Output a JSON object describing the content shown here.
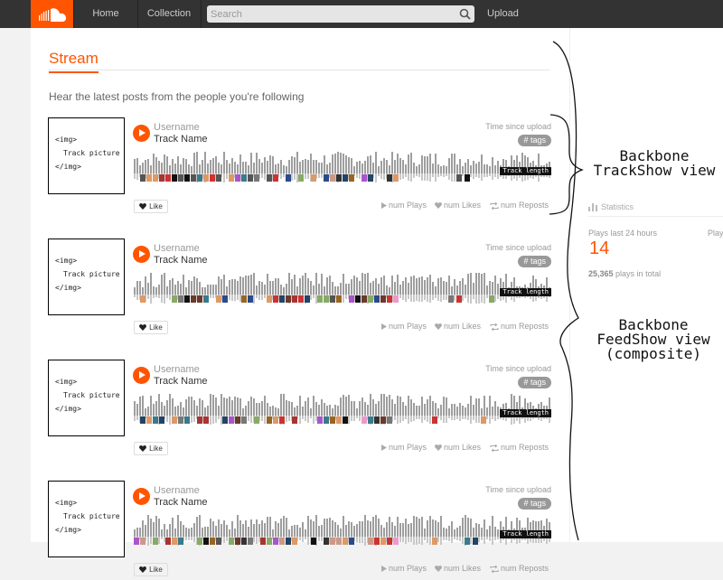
{
  "nav": {
    "home": "Home",
    "collection": "Collection",
    "search_placeholder": "Search",
    "upload": "Upload"
  },
  "stream": {
    "title": "Stream",
    "description": "Hear the latest posts from the people you're following"
  },
  "tracks": [
    {
      "art_lines": [
        "<img>",
        "Track picture",
        "</img>"
      ],
      "username": "Username",
      "track_name": "Track Name",
      "time_since": "Time since upload",
      "tags": "# tags",
      "length": "Track length",
      "like": "Like",
      "plays": "num Plays",
      "likes": "num Likes",
      "reposts": "num Reposts"
    },
    {
      "art_lines": [
        "<img>",
        "Track picture",
        "</img>"
      ],
      "username": "Username",
      "track_name": "Track Name",
      "time_since": "Time since upload",
      "tags": "# tags",
      "length": "Track length",
      "like": "Like",
      "plays": "num Plays",
      "likes": "num Likes",
      "reposts": "num Reposts"
    },
    {
      "art_lines": [
        "<img>",
        "Track picture",
        "</img>"
      ],
      "username": "Username",
      "track_name": "Track Name",
      "time_since": "Time since upload",
      "tags": "# tags",
      "length": "Track length",
      "like": "Like",
      "plays": "num Plays",
      "likes": "num Likes",
      "reposts": "num Reposts"
    },
    {
      "art_lines": [
        "<img>",
        "Track picture",
        "</img>"
      ],
      "username": "Username",
      "track_name": "Track Name",
      "time_since": "Time since upload",
      "tags": "# tags",
      "length": "Track length",
      "like": "Like",
      "plays": "num Plays",
      "likes": "num Likes",
      "reposts": "num Reposts"
    }
  ],
  "sidebar": {
    "statistics_label": "Statistics",
    "plays_24h_label": "Plays last 24 hours",
    "plays_24h_label_cut": "Play",
    "plays_24h_value": "14",
    "plays_total_value": "25,365",
    "plays_total_suffix": "plays in total"
  },
  "annotations": {
    "track_view": [
      "Backbone",
      "TrackShow view"
    ],
    "feed_view": [
      "Backbone",
      "FeedShow view",
      "(composite)"
    ]
  },
  "colors": {
    "accent": "#ff5500",
    "topbar": "#333333"
  },
  "icons": [
    "soundcloud-logo-icon",
    "search-icon",
    "play-icon",
    "heart-icon",
    "repost-icon",
    "statistics-icon"
  ]
}
